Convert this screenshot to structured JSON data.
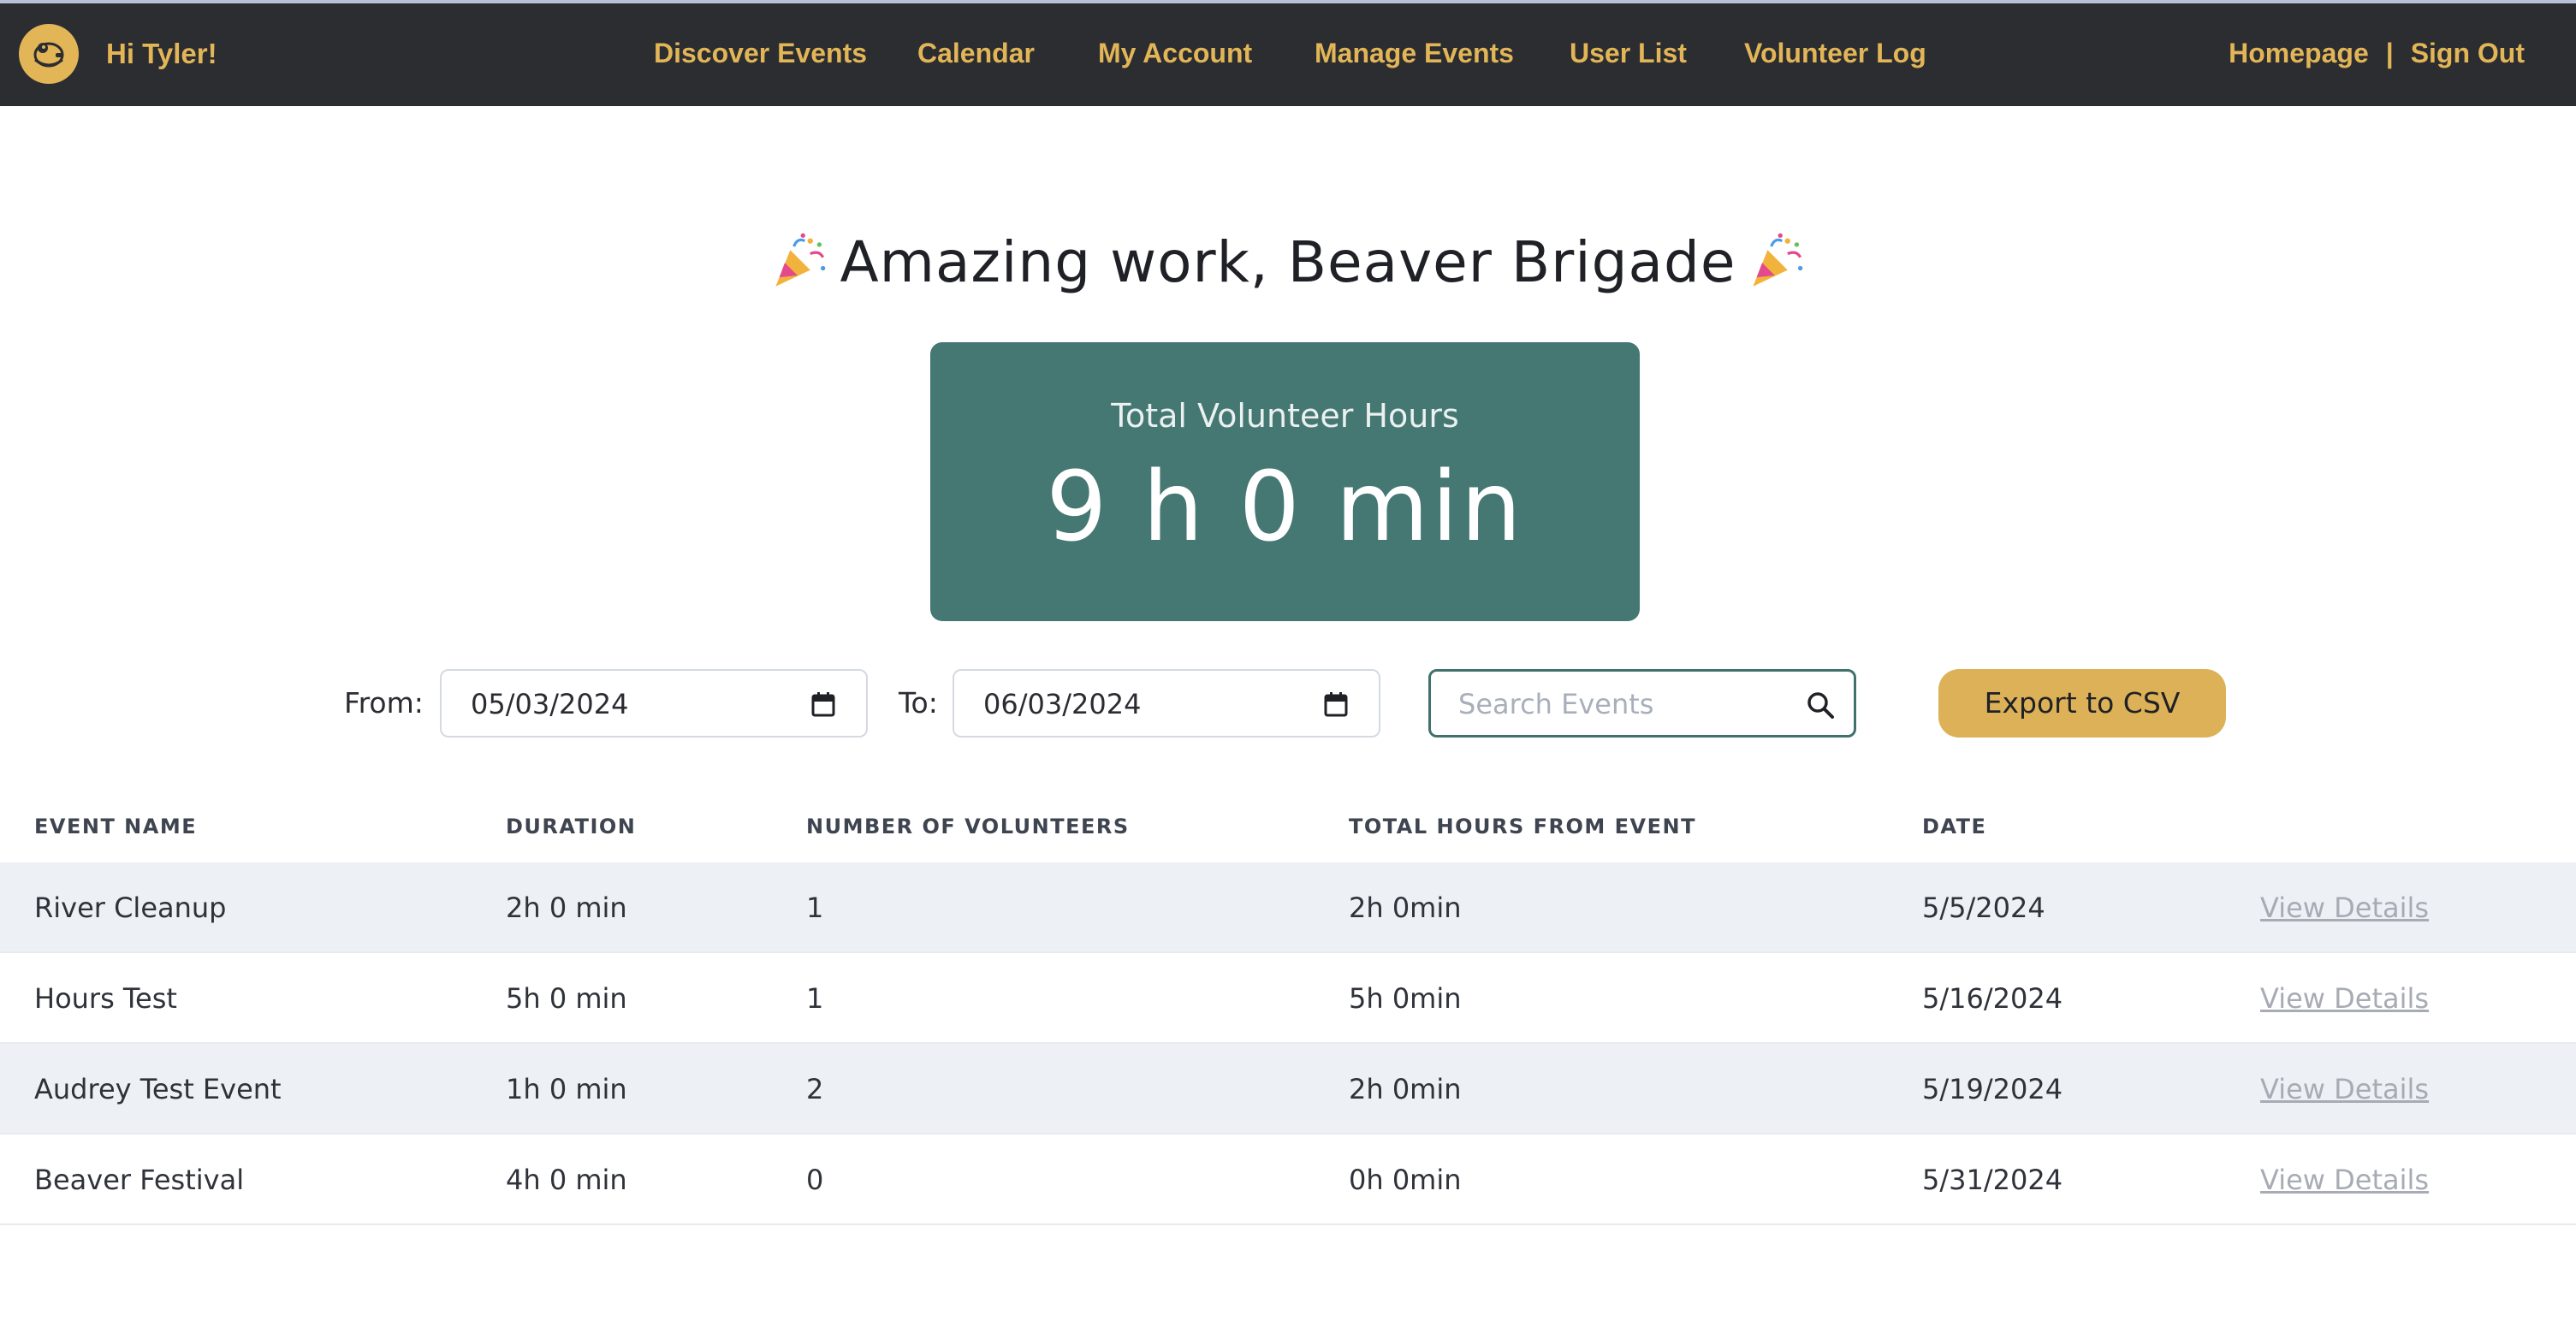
{
  "nav": {
    "greeting": "Hi Tyler!",
    "links": [
      "Discover Events",
      "Calendar",
      "My Account",
      "Manage Events",
      "User List",
      "Volunteer Log"
    ],
    "homepage": "Homepage",
    "separator": "|",
    "sign_out": "Sign Out"
  },
  "heading": {
    "text": "Amazing work, Beaver Brigade"
  },
  "total": {
    "label": "Total Volunteer Hours",
    "value": "9 h 0 min"
  },
  "filters": {
    "from_label": "From:",
    "from_value": "05/03/2024",
    "to_label": "To:",
    "to_value": "06/03/2024",
    "search_placeholder": "Search Events",
    "export_label": "Export to CSV"
  },
  "table": {
    "headers": [
      "EVENT NAME",
      "DURATION",
      "NUMBER OF VOLUNTEERS",
      "TOTAL HOURS FROM EVENT",
      "DATE"
    ],
    "rows": [
      {
        "name": "River Cleanup",
        "duration": "2h 0 min",
        "volunteers": "1",
        "total": "2h 0min",
        "date": "5/5/2024",
        "action": "View Details"
      },
      {
        "name": "Hours Test",
        "duration": "5h 0 min",
        "volunteers": "1",
        "total": "5h 0min",
        "date": "5/16/2024",
        "action": "View Details"
      },
      {
        "name": "Audrey Test Event",
        "duration": "1h 0 min",
        "volunteers": "2",
        "total": "2h 0min",
        "date": "5/19/2024",
        "action": "View Details"
      },
      {
        "name": "Beaver Festival",
        "duration": "4h 0 min",
        "volunteers": "0",
        "total": "0h 0min",
        "date": "5/31/2024",
        "action": "View Details"
      }
    ]
  },
  "colors": {
    "navbar_bg": "#2c2d31",
    "nav_text": "#e2b557",
    "card_bg": "#457773",
    "export_bg": "#dcb157",
    "row_alt": "#edf0f5"
  },
  "icons": [
    "beaver-logo-icon",
    "party-popper-icon",
    "calendar-icon",
    "search-icon"
  ]
}
